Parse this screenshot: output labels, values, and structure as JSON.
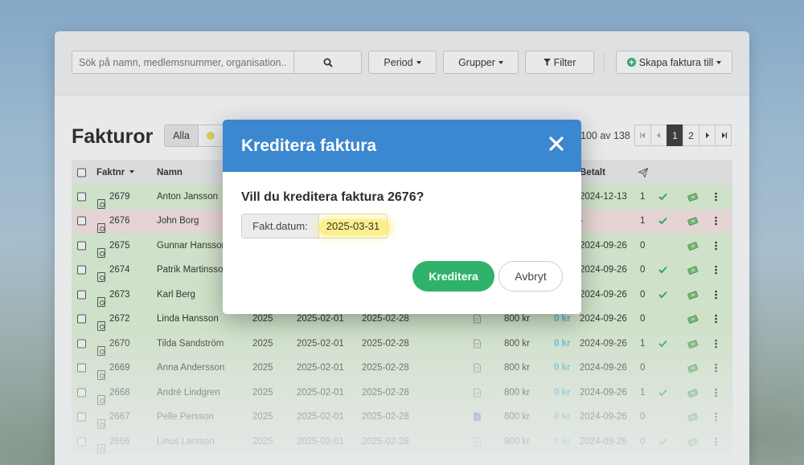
{
  "toolbar": {
    "search_placeholder": "Sök på namn, medlemsnummer, organisation...",
    "period_label": "Period",
    "grupper_label": "Grupper",
    "filter_label": "Filter",
    "skapa_label": "Skapa faktura till"
  },
  "page": {
    "title": "Fakturor",
    "filter_all": "Alla",
    "range_text": "100 av 138",
    "pages": [
      "1",
      "2"
    ]
  },
  "table": {
    "headers": {
      "faktnr": "Faktnr",
      "namn": "Namn",
      "betalt": "Betalt"
    },
    "rows": [
      {
        "nr": "2679",
        "name": "Anton Jansson",
        "year": "",
        "from": "",
        "to": "",
        "amount": "",
        "paid_amt": "",
        "paid_date": "2024-12-13",
        "sent": "1",
        "check": true,
        "status": "green"
      },
      {
        "nr": "2676",
        "name": "John Borg",
        "year": "",
        "from": "",
        "to": "",
        "amount": "",
        "paid_amt": "",
        "paid_date": "-",
        "sent": "1",
        "check": true,
        "status": "pink"
      },
      {
        "nr": "2675",
        "name": "Gunnar Hansson",
        "year": "",
        "from": "",
        "to": "",
        "amount": "",
        "paid_amt": "",
        "paid_date": "2024-09-26",
        "sent": "0",
        "check": false,
        "status": "green"
      },
      {
        "nr": "2674",
        "name": "Patrik Martinsson",
        "year": "",
        "from": "",
        "to": "",
        "amount": "",
        "paid_amt": "",
        "paid_date": "2024-09-26",
        "sent": "0",
        "check": true,
        "status": "green"
      },
      {
        "nr": "2673",
        "name": "Karl Berg",
        "year": "",
        "from": "",
        "to": "",
        "amount": "",
        "paid_amt": "",
        "paid_date": "2024-09-26",
        "sent": "0",
        "check": true,
        "status": "green"
      },
      {
        "nr": "2672",
        "name": "Linda Hansson",
        "year": "2025",
        "from": "2025-02-01",
        "to": "2025-02-28",
        "amount": "800 kr",
        "paid_amt": "0 kr",
        "paid_date": "2024-09-26",
        "sent": "0",
        "check": false,
        "status": "green"
      },
      {
        "nr": "2670",
        "name": "Tilda Sandström",
        "year": "2025",
        "from": "2025-02-01",
        "to": "2025-02-28",
        "amount": "800 kr",
        "paid_amt": "0 kr",
        "paid_date": "2024-09-26",
        "sent": "1",
        "check": true,
        "status": "green"
      },
      {
        "nr": "2669",
        "name": "Anna Andersson",
        "year": "2025",
        "from": "2025-02-01",
        "to": "2025-02-28",
        "amount": "800 kr",
        "paid_amt": "0 kr",
        "paid_date": "2024-09-26",
        "sent": "0",
        "check": false,
        "status": "green"
      },
      {
        "nr": "2668",
        "name": "André Lindgren",
        "year": "2025",
        "from": "2025-02-01",
        "to": "2025-02-28",
        "amount": "800 kr",
        "paid_amt": "0 kr",
        "paid_date": "2024-09-26",
        "sent": "1",
        "check": true,
        "status": "green"
      },
      {
        "nr": "2667",
        "name": "Pelle Persson",
        "year": "2025",
        "from": "2025-02-01",
        "to": "2025-02-28",
        "amount": "800 kr",
        "paid_amt": "0 kr",
        "paid_date": "2024-09-26",
        "sent": "0",
        "check": false,
        "status": "green"
      },
      {
        "nr": "2666",
        "name": "Linus Larsson",
        "year": "2025",
        "from": "2025-02-01",
        "to": "2025-02-28",
        "amount": "800 kr",
        "paid_amt": "0 kr",
        "paid_date": "2024-09-26",
        "sent": "0",
        "check": true,
        "status": "green"
      }
    ]
  },
  "modal": {
    "title": "Kreditera faktura",
    "question": "Vill du kreditera faktura 2676?",
    "date_label": "Fakt.datum:",
    "date_value": "2025-03-31",
    "confirm_label": "Kreditera",
    "cancel_label": "Avbryt"
  },
  "colors": {
    "modal_header": "#3b87d0",
    "confirm_button": "#2fb36b",
    "row_paid": "#e4f6d9",
    "row_credited": "#fde7e6",
    "highlight": "#faec78"
  },
  "icons": [
    "search-icon",
    "caret-down-icon",
    "filter-icon",
    "plus-circle-icon",
    "pdf-icon",
    "send-icon",
    "check-icon",
    "money-icon",
    "kebab-menu-icon",
    "close-icon",
    "document-icon"
  ]
}
